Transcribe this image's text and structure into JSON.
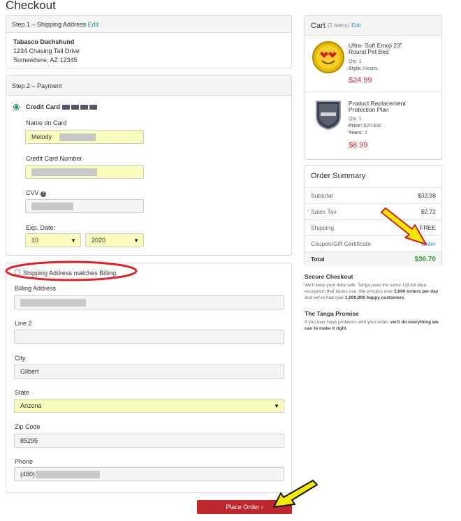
{
  "page": {
    "title": "Checkout"
  },
  "step1": {
    "title": "Step 1 – Shipping Address",
    "edit": "Edit",
    "name": "Tabasco Dachshund",
    "line1": "1234 Chasing Tail Drive",
    "line2": "Somewhere, AZ 12345"
  },
  "step2": {
    "title": "Step 2 – Payment",
    "method": "Credit Card",
    "card_logos": [
      "visa-icon",
      "mastercard-icon",
      "amex-icon",
      "discover-icon"
    ],
    "name_on_card_label": "Name on Card",
    "name_on_card_value": "Melody",
    "card_number_label": "Credit Card Number",
    "cvv_label": "CVV",
    "exp_label": "Exp. Date:",
    "exp_month": "10",
    "exp_year": "2020"
  },
  "billing": {
    "matches_label": "Shipping Address matches Billing",
    "matches_checked": false,
    "address_label": "Billing Address",
    "line2_label": "Line 2",
    "city_label": "City",
    "city_value": "Gilbert",
    "state_label": "State",
    "state_value": "Arizona",
    "zip_label": "Zip Code",
    "zip_value": "85295",
    "phone_label": "Phone",
    "phone_value": "(480)"
  },
  "place_order": "Place Order ›",
  "cart": {
    "title": "Cart",
    "count": "(2 items)",
    "edit": "Edit",
    "items": [
      {
        "name": "Ultra- Soft Emoji 23\" Round Pet Bed",
        "qty_label": "Qty:",
        "qty": "1",
        "attr_label": "Style:",
        "attr": "Hearts",
        "price": "$24.99",
        "image": "emoji-bed-image"
      },
      {
        "name": "Product Replacement Protection Plan",
        "qty_label": "Qty:",
        "qty": "1",
        "attr_label": "Price:",
        "attr": "$20-$30",
        "attr2_label": "Years:",
        "attr2": "2",
        "price": "$8.99",
        "image": "cps-shield-image"
      }
    ]
  },
  "summary": {
    "title": "Order Summary",
    "rows": [
      {
        "label": "Subtotal",
        "value": "$33.98"
      },
      {
        "label": "Sales Tax",
        "value": "$2.72"
      },
      {
        "label": "Shipping",
        "value": "FREE"
      },
      {
        "label": "Coupon/Gift Certificate",
        "value": "Enter"
      }
    ],
    "total_label": "Total",
    "total_value": "$36.70"
  },
  "secure": {
    "title": "Secure Checkout",
    "text_a": "We'll keep your data safe. Tanga uses the same 128-bit data encryption that banks use. We process over ",
    "text_b": "5,000 orders per day",
    "text_c": " and we've had over ",
    "text_d": "1,000,000 happy customers",
    "text_e": "."
  },
  "promise": {
    "title": "The Tanga Promise",
    "text_a": "If you ever have problems with your order, ",
    "text_b": "we'll do everything we can to make it right",
    "text_c": "."
  },
  "colors": {
    "accent": "#2d8fa8",
    "price_red": "#c0272d",
    "total_green": "#3a9a3a",
    "button": "#c0272d",
    "highlight_red": "#e01f26",
    "arrow_yellow": "#f5e800"
  }
}
